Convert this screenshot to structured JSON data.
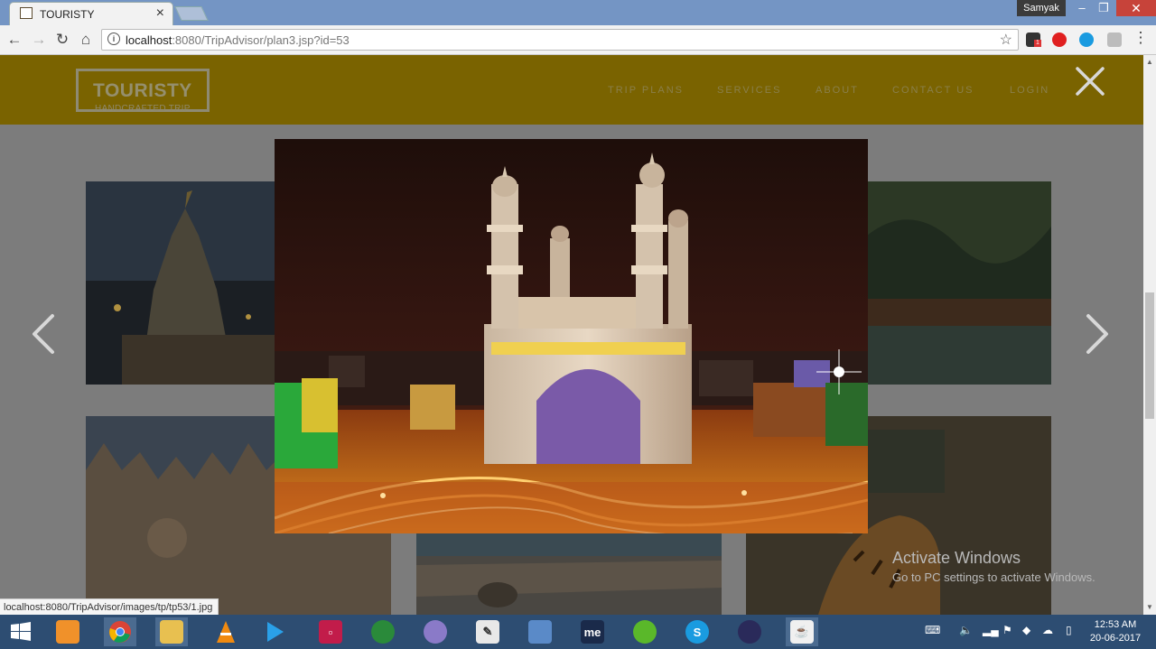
{
  "browser": {
    "tab_title": "TOURISTY",
    "tab_close": "×",
    "profile_name": "Samyak",
    "window_min": "–",
    "window_max": "❐",
    "window_close": "✕",
    "url_host": "localhost",
    "url_rest": ":8080/TripAdvisor/plan3.jsp?id=53",
    "status_url": "localhost:8080/TripAdvisor/images/tp/tp53/1.jpg",
    "extension_badge": "1"
  },
  "site": {
    "logo_name": "TOURISTY",
    "logo_tagline": "HANDCRAFTED TRIP",
    "nav": [
      {
        "label": "TRIP PLANS"
      },
      {
        "label": "SERVICES"
      },
      {
        "label": "ABOUT"
      },
      {
        "label": "CONTACT US"
      },
      {
        "label": "LOGIN"
      }
    ],
    "accent_color": "#c9a100"
  },
  "gallery": {
    "cards": [
      {
        "name": "temple-tower-night"
      },
      {
        "name": "forest-mangroves"
      },
      {
        "name": "palace-domes"
      },
      {
        "name": "ruins-elephant"
      },
      {
        "name": "tiger-jeep"
      }
    ],
    "lightbox_image": "charminar-night"
  },
  "watermark": {
    "line1": "Activate Windows",
    "line2": "Go to PC settings to activate Windows."
  },
  "taskbar": {
    "apps": [
      {
        "name": "start-icon"
      },
      {
        "name": "app-orange-icon"
      },
      {
        "name": "chrome-icon"
      },
      {
        "name": "file-explorer-icon"
      },
      {
        "name": "vlc-icon"
      },
      {
        "name": "media-player-icon"
      },
      {
        "name": "screen-recorder-icon"
      },
      {
        "name": "globe-download-icon"
      },
      {
        "name": "circle-app-icon"
      },
      {
        "name": "notepad-icon"
      },
      {
        "name": "dolphin-icon"
      },
      {
        "name": "me-app-icon"
      },
      {
        "name": "green-app-icon"
      },
      {
        "name": "skype-icon"
      },
      {
        "name": "eclipse-icon"
      },
      {
        "name": "java-icon"
      }
    ],
    "me_label": "me",
    "clock_time": "12:53 AM",
    "clock_date": "20-06-2017"
  }
}
